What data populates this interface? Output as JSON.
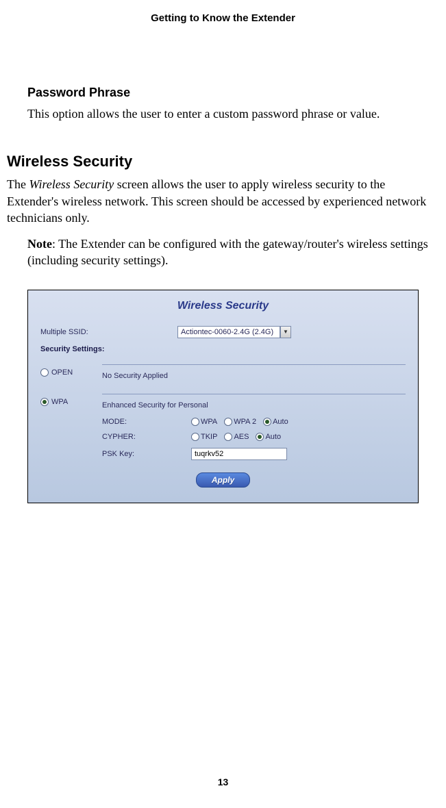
{
  "header": "Getting to Know the Extender",
  "subsection": {
    "heading": "Password Phrase",
    "body": "This option allows the user to enter a custom password phrase or value."
  },
  "section": {
    "heading": "Wireless Security",
    "body_prefix": "The ",
    "body_italic": "Wireless Security",
    "body_suffix": " screen allows the user to apply wireless security to the Extender's wireless network. This screen should be accessed by experienced network technicians only."
  },
  "note": {
    "label": "Note",
    "text": ": The Extender can be configured with the gateway/router's wireless settings (including security settings)."
  },
  "ui": {
    "title": "Wireless Security",
    "ssid_label": "Multiple SSID:",
    "ssid_value": "Actiontec-0060-2.4G (2.4G)",
    "settings_label": "Security Settings:",
    "open": {
      "label": "OPEN",
      "desc": "No Security Applied"
    },
    "wpa": {
      "label": "WPA",
      "desc": "Enhanced Security for Personal",
      "mode_label": "MODE:",
      "mode_opts": [
        "WPA",
        "WPA 2",
        "Auto"
      ],
      "cypher_label": "CYPHER:",
      "cypher_opts": [
        "TKIP",
        "AES",
        "Auto"
      ],
      "psk_label": "PSK Key:",
      "psk_value": "tuqrkv52"
    },
    "apply": "Apply"
  },
  "page_number": "13"
}
